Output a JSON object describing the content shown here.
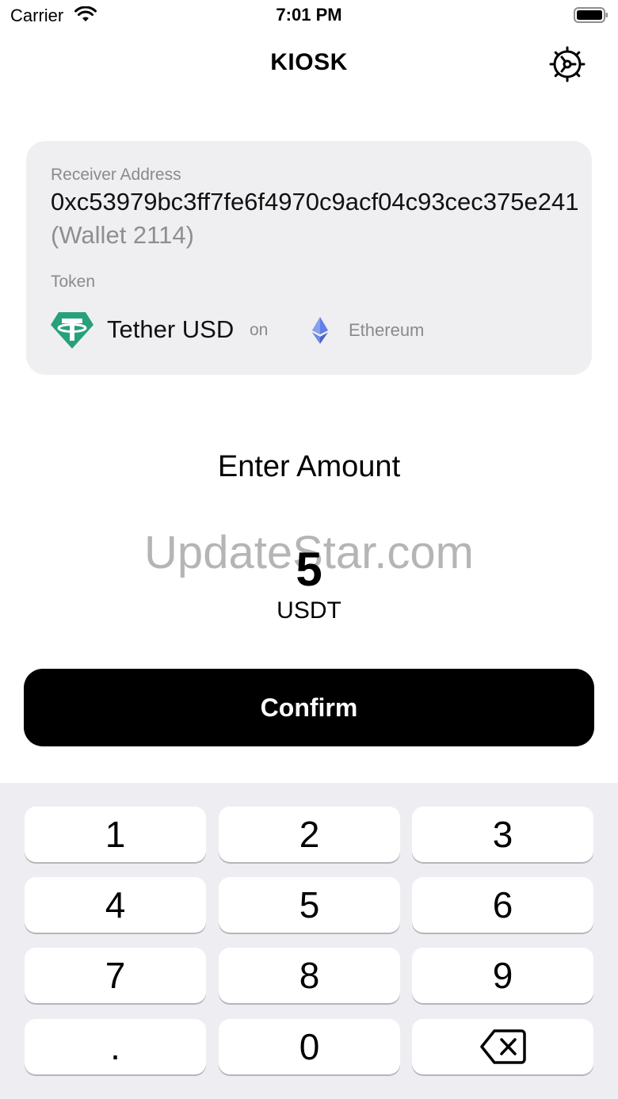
{
  "status_bar": {
    "carrier": "Carrier",
    "time": "7:01 PM"
  },
  "nav": {
    "title": "KIOSK",
    "settings_icon": "gear-icon"
  },
  "card": {
    "receiver_label": "Receiver Address",
    "address": "0xc53979bc3ff7fe6f4970c9acf04c93cec375e241",
    "wallet_name": "(Wallet 2114)",
    "token_label": "Token",
    "token_name": "Tether USD",
    "on_label": "on",
    "network_name": "Ethereum"
  },
  "amount": {
    "prompt": "Enter Amount",
    "value": "5",
    "unit": "USDT"
  },
  "watermark": "UpdateStar.com",
  "confirm_label": "Confirm",
  "keypad": {
    "keys": [
      "1",
      "2",
      "3",
      "4",
      "5",
      "6",
      "7",
      "8",
      "9",
      ".",
      "0"
    ],
    "backspace_icon": "backspace-icon"
  },
  "colors": {
    "card_bg": "#efeff1",
    "secondary_text": "#8a8a8e",
    "button_bg": "#000000",
    "keypad_bg": "#eeeef2",
    "tether_green": "#26a17b",
    "ethereum": "#627eea"
  }
}
